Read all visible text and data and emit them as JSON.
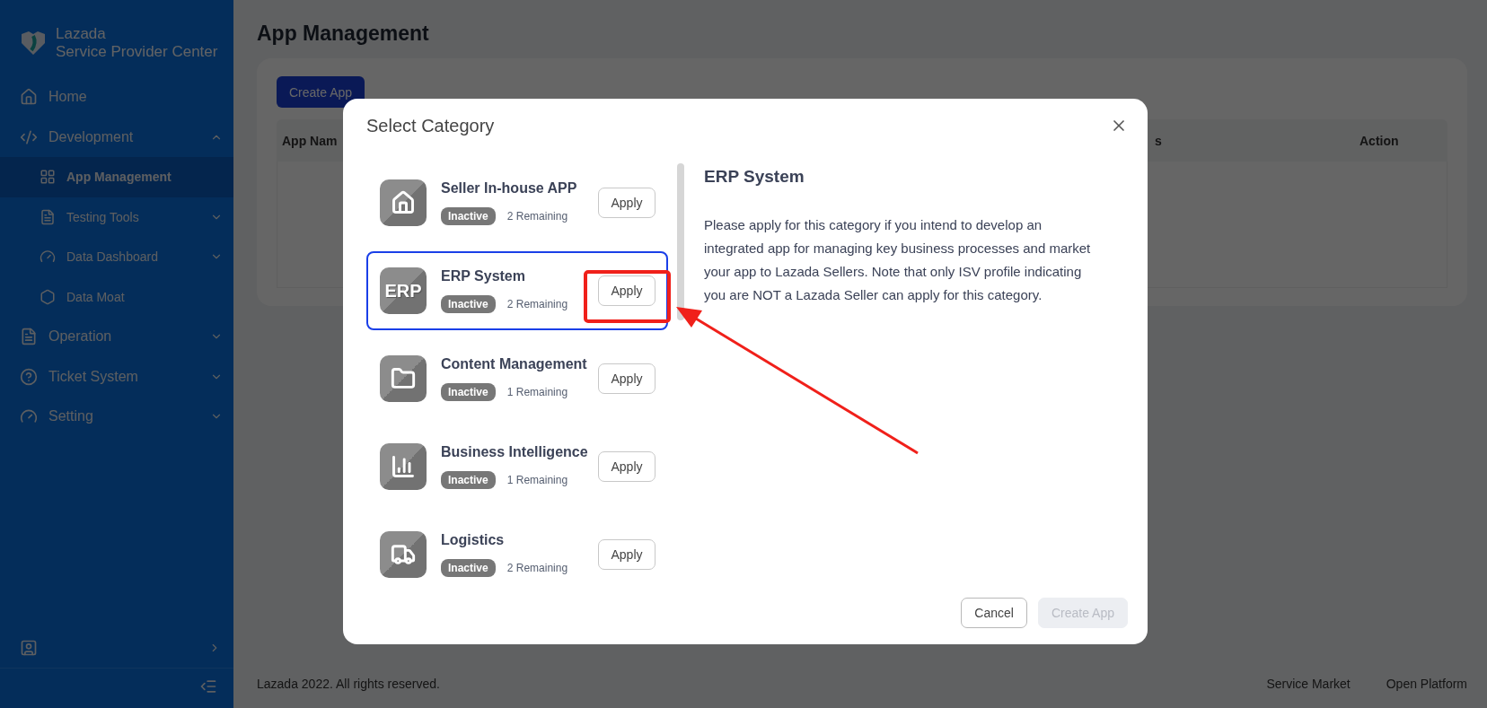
{
  "sidebar": {
    "brand": {
      "line1": "Lazada",
      "line2": "Service Provider Center"
    },
    "items": [
      {
        "label": "Home",
        "kind": "link",
        "selected": false
      },
      {
        "label": "Development",
        "kind": "group",
        "expanded": true,
        "selected": false,
        "children": [
          {
            "label": "App Management",
            "kind": "link",
            "selected": true
          },
          {
            "label": "Testing Tools",
            "kind": "group",
            "expanded": false,
            "selected": false
          },
          {
            "label": "Data Dashboard",
            "kind": "group",
            "expanded": false,
            "selected": false
          },
          {
            "label": "Data Moat",
            "kind": "link",
            "selected": false
          }
        ]
      },
      {
        "label": "Operation",
        "kind": "group",
        "expanded": false,
        "selected": false
      },
      {
        "label": "Ticket System",
        "kind": "group",
        "expanded": false,
        "selected": false
      },
      {
        "label": "Setting",
        "kind": "group",
        "expanded": false,
        "selected": false
      }
    ]
  },
  "page": {
    "title": "App Management",
    "create_button": "Create App",
    "table": {
      "columns": [
        "App Nam",
        "s",
        "Action"
      ]
    }
  },
  "footer": {
    "copyright": "Lazada 2022. All rights reserved.",
    "links": [
      "Service Market",
      "Open Platform"
    ]
  },
  "dialog": {
    "title": "Select Category",
    "categories": [
      {
        "name": "Seller In-house APP",
        "status": "Inactive",
        "remaining": "2 Remaining",
        "button": "Apply",
        "selected": false
      },
      {
        "name": "ERP System",
        "icon_label": "ERP",
        "status": "Inactive",
        "remaining": "2 Remaining",
        "button": "Apply",
        "selected": true
      },
      {
        "name": "Content Management",
        "status": "Inactive",
        "remaining": "1 Remaining",
        "button": "Apply",
        "selected": false
      },
      {
        "name": "Business Intelligence",
        "status": "Inactive",
        "remaining": "1 Remaining",
        "button": "Apply",
        "selected": false
      },
      {
        "name": "Logistics",
        "status": "Inactive",
        "remaining": "2 Remaining",
        "button": "Apply",
        "selected": false
      }
    ],
    "detail": {
      "title": "ERP System",
      "description": "Please apply for this category if you intend to develop an integrated app for managing key business processes and market your app to Lazada Sellers. Note that only ISV profile indicating you are NOT a Lazada Seller can apply for this category."
    },
    "buttons": [
      {
        "label": "Cancel",
        "disabled": false
      },
      {
        "label": "Create App",
        "disabled": true
      }
    ]
  }
}
